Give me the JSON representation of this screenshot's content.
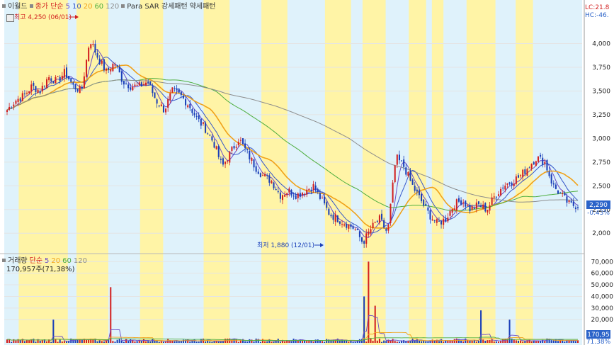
{
  "colors": {
    "band": "#fff4a6",
    "bandAlt": "#dff2fb",
    "up": "#d21f1f",
    "down": "#1a3fb8",
    "ma5": "#6a4cc7",
    "ma10": "#3557c9",
    "ma20": "#f0a21a",
    "ma60": "#4fae3f",
    "ma120": "#8d8d8d",
    "priceTag": "#2b63c9"
  },
  "legend_price": {
    "name": "이월드",
    "type": "종가 단순",
    "p5": "5",
    "p10": "10",
    "p20": "20",
    "p60": "60",
    "p120": "120",
    "ind1": "Para SAR 강세패턴",
    "ind2": "약세패턴"
  },
  "legend_volume": {
    "name": "거래량",
    "type": "단순",
    "p5": "5",
    "p20": "20",
    "p60": "60",
    "p120": "120",
    "current": "170,957주(71,38%)"
  },
  "corner": {
    "lc": "LC:21.8",
    "hc": "HC:-46."
  },
  "annotations": {
    "high": "최고 4,250 (06/01)",
    "low": "최저 1,880 (12/01)"
  },
  "current_price": {
    "price": "2,290",
    "change": "-0.43%"
  },
  "current_volume": {
    "label": "170,95",
    "pct": "71.38%"
  },
  "chart_data": {
    "type": "candlestick",
    "price_axis": {
      "min": 1800,
      "max": 4400,
      "ticks": [
        "4,000",
        "3,750",
        "3,500",
        "3,250",
        "3,000",
        "2,750",
        "2,500",
        "2,250",
        "2,000"
      ],
      "tick_values": [
        4000,
        3750,
        3500,
        3250,
        3000,
        2750,
        2500,
        2250,
        2000
      ]
    },
    "volume_axis": {
      "min": 0,
      "max": 72000,
      "ticks": [
        "70,000",
        "60,000",
        "50,000",
        "40,000",
        "30,000",
        "20,000"
      ],
      "tick_values": [
        70000,
        60000,
        50000,
        40000,
        30000,
        20000
      ]
    },
    "price_key": [
      3300,
      3400,
      3450,
      3550,
      3500,
      3650,
      3600,
      3700,
      3550,
      3500,
      4050,
      3850,
      3700,
      3800,
      3600,
      3550,
      3550,
      3600,
      3400,
      3300,
      3500,
      3450,
      3350,
      3200,
      3100,
      2950,
      2700,
      2850,
      3000,
      2850,
      2700,
      2600,
      2550,
      2400,
      2450,
      2400,
      2450,
      2500,
      2350,
      2200,
      2150,
      2100,
      2050,
      1900,
      2050,
      2150,
      2000,
      2800,
      2700,
      2500,
      2350,
      2200,
      2100,
      2150,
      2300,
      2350,
      2250,
      2300,
      2250,
      2400,
      2500,
      2550,
      2600,
      2700,
      2800,
      2750,
      2500,
      2400,
      2300,
      2290
    ],
    "volume_spikes": [
      {
        "i": 0.08,
        "v": 20000
      },
      {
        "i": 0.18,
        "v": 48000
      },
      {
        "i": 0.625,
        "v": 40000
      },
      {
        "i": 0.635,
        "v": 70000
      },
      {
        "i": 0.645,
        "v": 32000
      },
      {
        "i": 0.83,
        "v": 28000
      },
      {
        "i": 0.88,
        "v": 20000
      }
    ]
  }
}
